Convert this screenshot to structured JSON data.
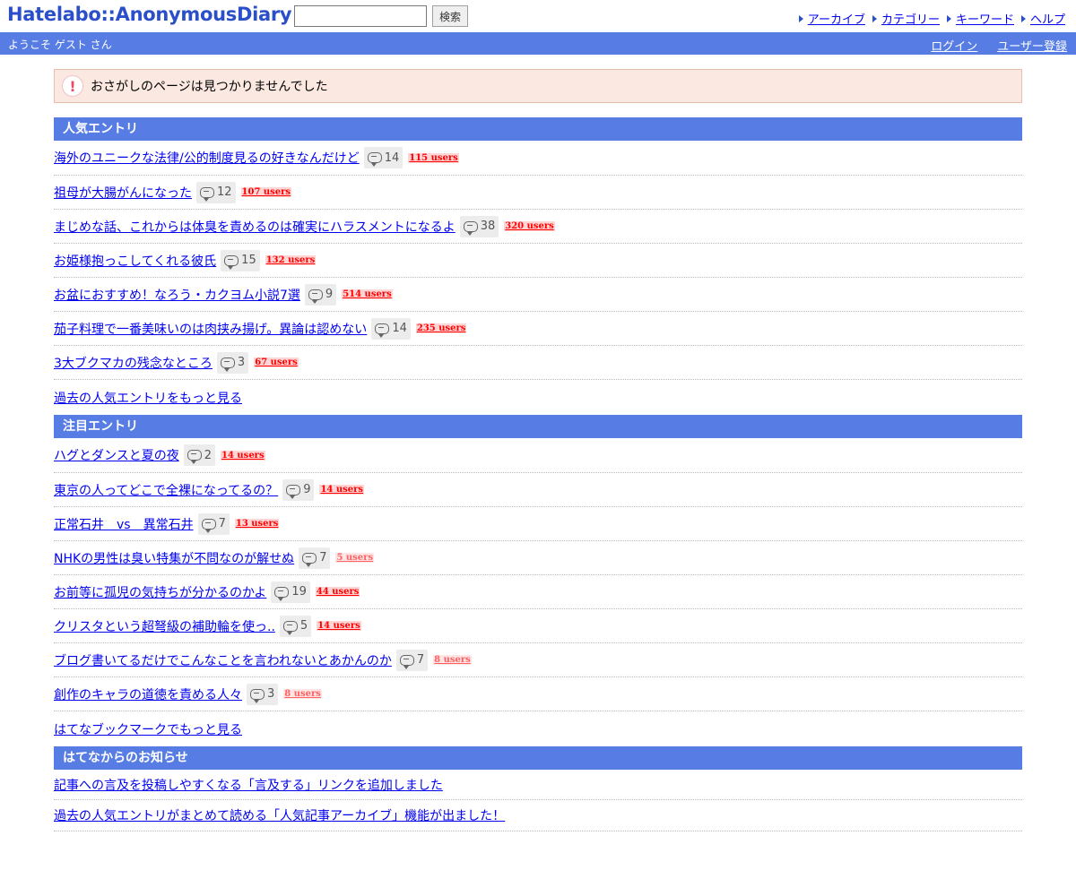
{
  "header": {
    "logo": "Hatelabo::AnonymousDiary",
    "search_placeholder": "",
    "search_button": "検索",
    "nav": [
      {
        "label": "アーカイブ"
      },
      {
        "label": "カテゴリー"
      },
      {
        "label": "キーワード"
      },
      {
        "label": "ヘルプ"
      }
    ]
  },
  "userbar": {
    "welcome": "ようこそ ゲスト さん",
    "login": "ログイン",
    "register": "ユーザー登録"
  },
  "alert": {
    "message": "おさがしのページは見つかりませんでした"
  },
  "popular": {
    "title": "人気エントリ",
    "entries": [
      {
        "title": "海外のユニークな法律/公的制度見るの好きなんだけど",
        "comments": "14",
        "users": "115 users"
      },
      {
        "title": "祖母が大腸がんになった",
        "comments": "12",
        "users": "107 users"
      },
      {
        "title": "まじめな話、これからは体臭を責めるのは確実にハラスメントになるよ",
        "comments": "38",
        "users": "320 users"
      },
      {
        "title": "お姫様抱っこしてくれる彼氏",
        "comments": "15",
        "users": "132 users"
      },
      {
        "title": "お盆におすすめ！なろう・カクヨム小説7選",
        "comments": "9",
        "users": "514 users"
      },
      {
        "title": "茄子料理で一番美味いのは肉挟み揚げ。異論は認めない",
        "comments": "14",
        "users": "235 users"
      },
      {
        "title": "3大ブクマカの残念なところ",
        "comments": "3",
        "users": "67 users"
      }
    ],
    "more": "過去の人気エントリをもっと見る"
  },
  "featured": {
    "title": "注目エントリ",
    "entries": [
      {
        "title": "ハグとダンスと夏の夜",
        "comments": "2",
        "users": "14 users"
      },
      {
        "title": "東京の人ってどこで全裸になってるの？",
        "comments": "9",
        "users": "14 users"
      },
      {
        "title": "正常石井　vs　異常石井",
        "comments": "7",
        "users": "13 users"
      },
      {
        "title": "NHKの男性は臭い特集が不問なのが解せぬ",
        "comments": "7",
        "users": "5 users"
      },
      {
        "title": "お前等に孤児の気持ちが分かるのかよ",
        "comments": "19",
        "users": "44 users"
      },
      {
        "title": "クリスタという超弩級の補助輪を使っ..",
        "comments": "5",
        "users": "14 users"
      },
      {
        "title": "ブログ書いてるだけでこんなことを言われないとあかんのか",
        "comments": "7",
        "users": "8 users"
      },
      {
        "title": "創作のキャラの道徳を責める人々",
        "comments": "3",
        "users": "8 users"
      }
    ],
    "more": "はてなブックマークでもっと見る"
  },
  "news": {
    "title": "はてなからのお知らせ",
    "entries": [
      {
        "title": "記事への言及を投稿しやすくなる「言及する」リンクを追加しました"
      },
      {
        "title": "過去の人気エントリがまとめて読める「人気記事アーカイブ」機能が出ました！"
      }
    ]
  },
  "colors": {
    "brand_blue": "#577ce4",
    "logo_blue": "#2a4fc9",
    "users_red": "#ff0000",
    "alert_bg": "#fbe8e1"
  }
}
